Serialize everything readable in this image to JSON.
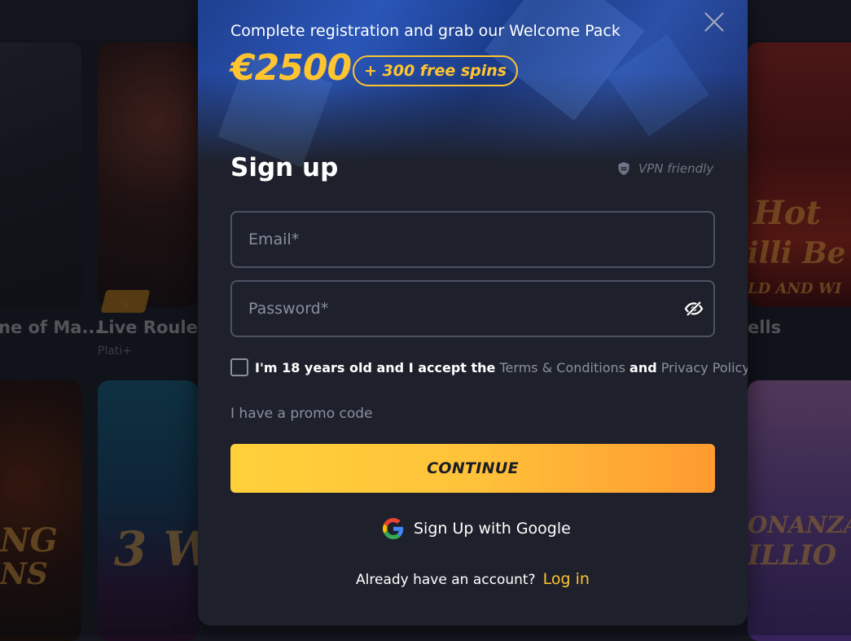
{
  "background": {
    "games": [
      {
        "title": "ne of Ma...",
        "subtitle": ""
      },
      {
        "title": "Live Roulette",
        "subtitle": "Plati+"
      },
      {
        "title": "ells",
        "subtitle": ""
      }
    ],
    "slot_texts": [
      "Hot",
      "illi Be",
      "LD AND WI",
      "NG",
      "NS",
      "3 W",
      "ONANZA",
      "ILLIO"
    ]
  },
  "modal": {
    "welcome_text": "Complete registration and grab our Welcome Pack",
    "amount": "€2500",
    "spins": "+ 300 free spins",
    "heading": "Sign up",
    "vpn_label": "VPN friendly",
    "email_placeholder": "Email*",
    "password_placeholder": "Password*",
    "agree": {
      "prefix": "I'm 18 years old and I accept the",
      "terms_link": "Terms & Conditions",
      "and": "and",
      "privacy_link": "Privacy Policy"
    },
    "promo_label": "I have a promo code",
    "continue_label": "CONTINUE",
    "google_label": "Sign Up with Google",
    "login_question": "Already have an account?",
    "login_link": "Log in"
  },
  "colors": {
    "accent": "#ffc530",
    "modal_bg": "#1e212c",
    "input_border": "#4d5263",
    "muted_text": "#8a8fa0"
  }
}
